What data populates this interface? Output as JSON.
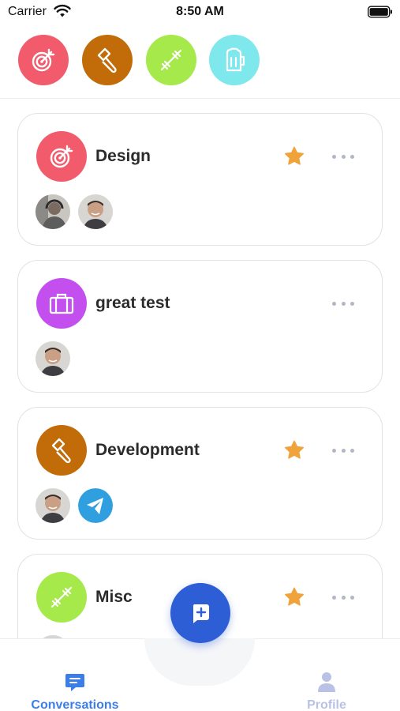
{
  "status_bar": {
    "carrier": "Carrier",
    "time": "8:50 AM"
  },
  "top_categories": [
    {
      "name": "target",
      "color": "#f15b6c",
      "icon": "target-icon"
    },
    {
      "name": "hammer",
      "color": "#c16c09",
      "icon": "hammer-icon"
    },
    {
      "name": "dumbbell",
      "color": "#a6e94a",
      "icon": "dumbbell-icon"
    },
    {
      "name": "beer",
      "color": "#7ee8ec",
      "icon": "beer-mug-icon"
    }
  ],
  "conversations": [
    {
      "title": "Design",
      "icon": "target-icon",
      "color": "#f15b6c",
      "starred": true,
      "members": [
        "person-headphones",
        "person-man"
      ]
    },
    {
      "title": "great test",
      "icon": "briefcase-icon",
      "color": "#c350ee",
      "starred": false,
      "members": [
        "person-man"
      ]
    },
    {
      "title": "Development",
      "icon": "hammer-icon",
      "color": "#c16c09",
      "starred": true,
      "members": [
        "person-man",
        "telegram-bot"
      ]
    },
    {
      "title": "Misc",
      "icon": "dumbbell-icon",
      "color": "#a6e94a",
      "starred": true,
      "members": [
        "person-man"
      ]
    }
  ],
  "fab": {
    "icon": "add-conversation-icon",
    "color": "#2d5ed6"
  },
  "tabs": [
    {
      "label": "Conversations",
      "icon": "chat-icon",
      "active": true,
      "color": "#3b7de9"
    },
    {
      "label": "Profile",
      "icon": "person-icon",
      "active": false,
      "color": "#b9c2e4"
    }
  ],
  "colors": {
    "star": "#f0a23b",
    "more_dots": "#b3b6c4",
    "card_border": "#e2e2e2"
  }
}
